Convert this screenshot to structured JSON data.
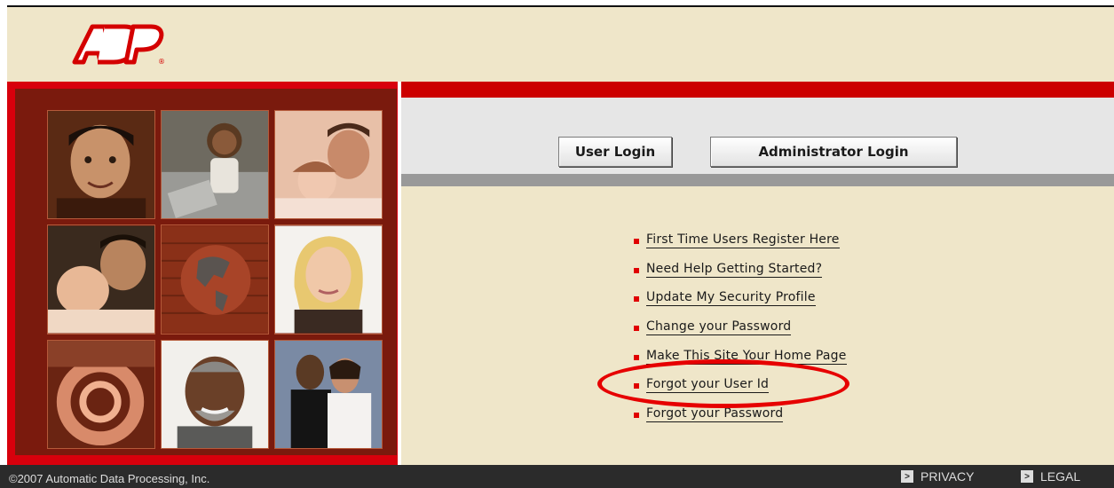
{
  "brand": {
    "logo_text": "ADP",
    "color": "#d40000"
  },
  "buttons": {
    "user_login": "User Login",
    "admin_login": "Administrator Login"
  },
  "links": [
    "First Time Users Register Here",
    "Need Help Getting Started?",
    "Update My Security Profile",
    "Change your Password",
    "Make This Site Your Home Page",
    "Forgot your User Id",
    "Forgot your Password"
  ],
  "highlighted_link": "Forgot your User Id",
  "footer": {
    "copyright": "©2007 Automatic Data Processing, Inc.",
    "privacy": "PRIVACY",
    "legal": "LEGAL"
  },
  "colors": {
    "accent_red": "#cc0000",
    "panel_bg": "#efe6c9",
    "photo_frame": "#7a1a0d",
    "footer_bg": "#2b2b2b"
  }
}
